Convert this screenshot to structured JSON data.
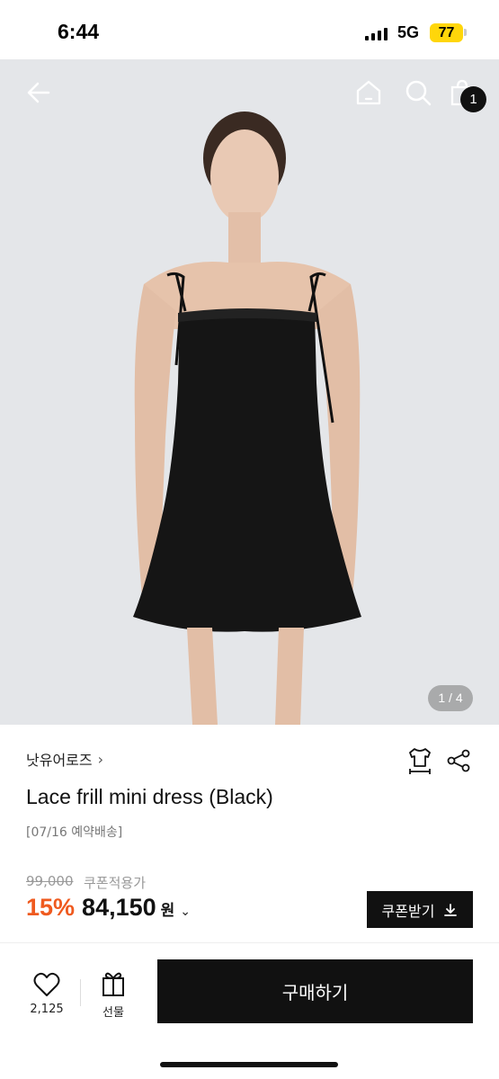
{
  "status_bar": {
    "time": "6:44",
    "network": "5G",
    "battery": "77"
  },
  "hero": {
    "page_indicator": "1 / 4",
    "cart_count": "1"
  },
  "product": {
    "brand": "낫유어로즈",
    "title": "Lace frill mini dress (Black)",
    "delivery_note": "[07/16 예약배송]",
    "original_price": "99,000",
    "coupon_note": "쿠폰적용가",
    "discount": "15%",
    "price": "84,150",
    "currency": "원",
    "coupon_button": "쿠폰받기"
  },
  "bottom_bar": {
    "like_count": "2,125",
    "gift_label": "선물",
    "buy_label": "구매하기"
  },
  "colors": {
    "discount": "#ef5a1f",
    "primary": "#111111",
    "battery": "#ffd60a"
  }
}
